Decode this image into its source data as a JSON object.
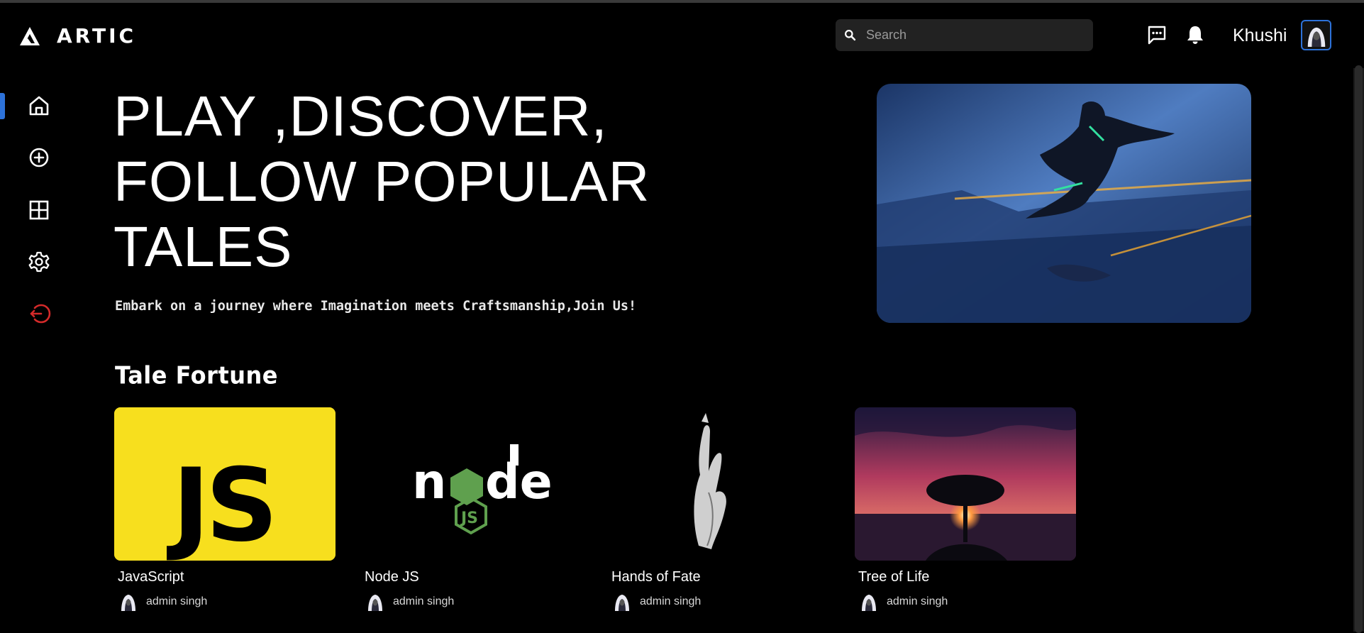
{
  "header": {
    "brand": "ARTIC",
    "search_placeholder": "Search",
    "username": "Khushi"
  },
  "sidebar": {
    "items": [
      {
        "icon": "home-icon",
        "active": true
      },
      {
        "icon": "plus-circle-icon",
        "active": false
      },
      {
        "icon": "grid-icon",
        "active": false
      },
      {
        "icon": "gear-icon",
        "active": false
      },
      {
        "icon": "logout-icon",
        "active": false,
        "color": "#d42a2a"
      }
    ]
  },
  "hero": {
    "title_line1": "PLAY ,DISCOVER,",
    "title_line2": "FOLLOW POPULAR",
    "title_line3": "TALES",
    "subtitle": "Embark on a journey where Imagination meets Craftsmanship,Join Us!"
  },
  "section": {
    "title": "Tale Fortune",
    "cards": [
      {
        "title": "JavaScript",
        "author": "admin singh"
      },
      {
        "title": "Node JS",
        "author": "admin singh"
      },
      {
        "title": "Hands of Fate",
        "author": "admin singh"
      },
      {
        "title": "Tree of Life",
        "author": "admin singh"
      }
    ]
  },
  "colors": {
    "accent": "#2d72d9",
    "js_yellow": "#f7df1e",
    "logout_red": "#d42a2a"
  }
}
